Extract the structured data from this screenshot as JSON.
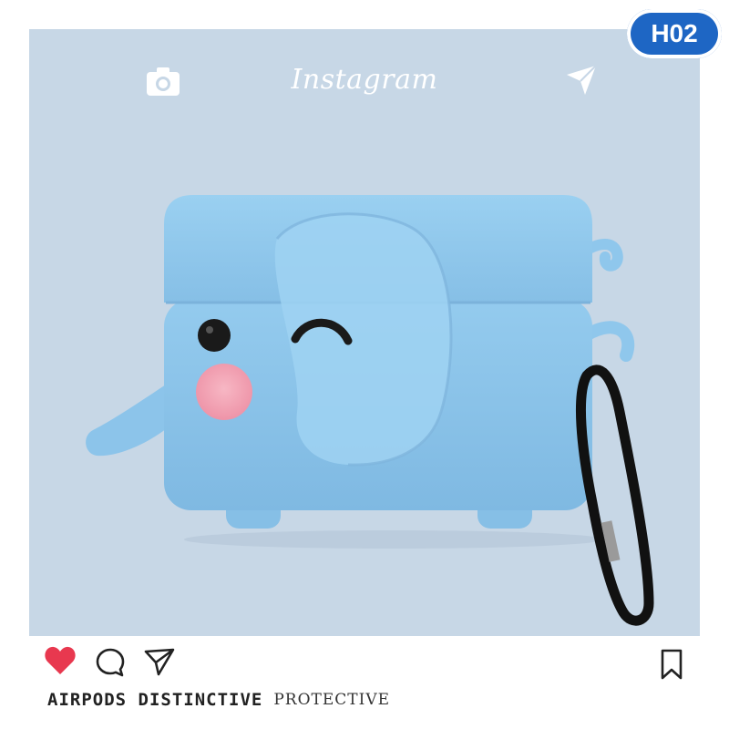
{
  "badge": {
    "label": "H02"
  },
  "instagram": {
    "logo_text": "Instagram",
    "header_icons": [
      "camera-icon",
      "send-icon"
    ],
    "action_icons": [
      "heart-icon",
      "comment-icon",
      "share-icon",
      "bookmark-icon"
    ],
    "heart_color": "#e8384f"
  },
  "product": {
    "type": "elephant-airpods-case",
    "case_color": "#8fc7ec",
    "cheek_color": "#f3a5b6",
    "carabiner_color": "#111111"
  },
  "caption": {
    "part1": "AIRPODS DISTINCTIVE",
    "part2": "PROTECTIVE"
  },
  "colors": {
    "background": "#c7d7e6",
    "frame": "#ffffff",
    "badge": "#1e66c4"
  }
}
